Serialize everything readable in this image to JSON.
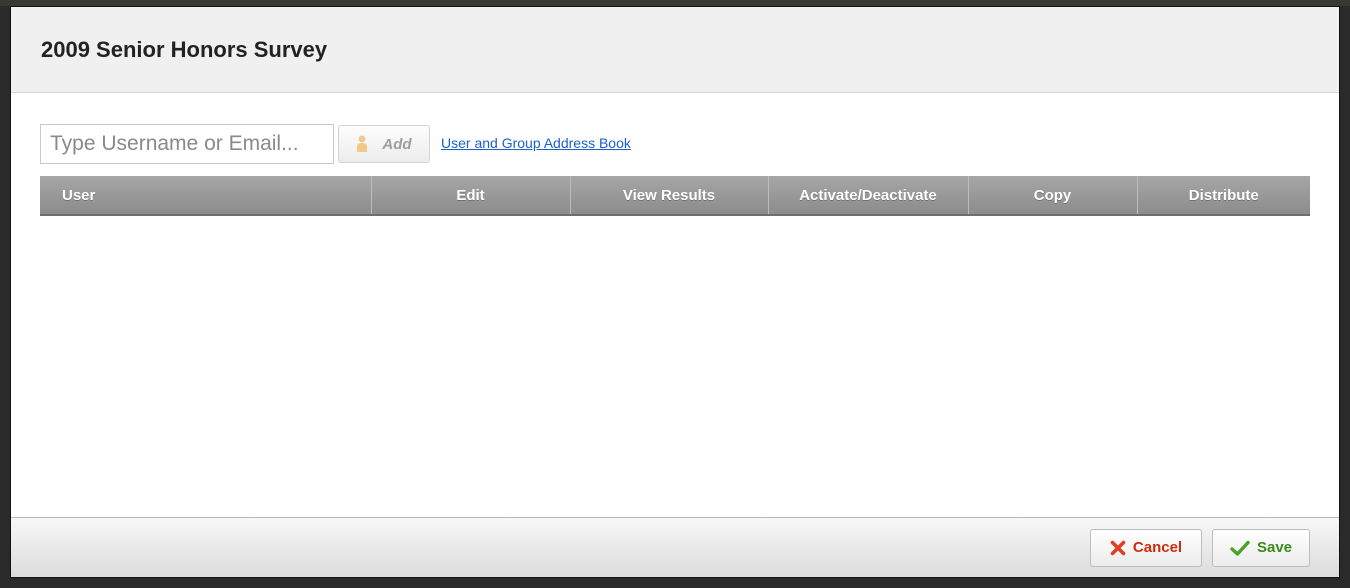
{
  "dialog": {
    "title": "2009 Senior Honors Survey"
  },
  "add_user": {
    "placeholder": "Type Username or Email...",
    "value": "",
    "add_label": "Add",
    "add_icon": "person-icon",
    "address_book_link": "User and Group Address Book"
  },
  "table": {
    "columns": [
      {
        "label": "User"
      },
      {
        "label": "Edit"
      },
      {
        "label": "View Results"
      },
      {
        "label": "Activate/Deactivate"
      },
      {
        "label": "Copy"
      },
      {
        "label": "Distribute"
      }
    ],
    "rows": []
  },
  "footer": {
    "cancel_label": "Cancel",
    "cancel_icon": "x-icon",
    "save_label": "Save",
    "save_icon": "checkmark-icon"
  },
  "colors": {
    "cancel": "#d02a10",
    "save": "#3b8c1a",
    "link": "#1a5fcc",
    "table_header": "#999999"
  }
}
